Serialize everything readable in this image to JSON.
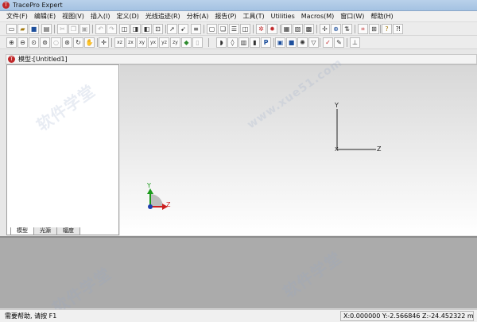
{
  "window": {
    "title": "TracePro Expert"
  },
  "menu": [
    {
      "label": "文件(F)"
    },
    {
      "label": "编辑(E)"
    },
    {
      "label": "视图(V)"
    },
    {
      "label": "插入(I)"
    },
    {
      "label": "定义(D)"
    },
    {
      "label": "光线追迹(R)"
    },
    {
      "label": "分析(A)"
    },
    {
      "label": "报告(P)"
    },
    {
      "label": "工具(T)"
    },
    {
      "label": "Utilities"
    },
    {
      "label": "Macros(M)"
    },
    {
      "label": "窗口(W)"
    },
    {
      "label": "帮助(H)"
    }
  ],
  "document": {
    "title": "模型:[Untitled1]"
  },
  "tree_tabs": [
    {
      "label": "模型"
    },
    {
      "label": "光源"
    },
    {
      "label": "辐度"
    }
  ],
  "viewport": {
    "axis_y": "Y",
    "axis_x": "X",
    "axis_z": "Z",
    "triad_y": "Y",
    "triad_z": "Z"
  },
  "status": {
    "help": "需要帮助, 请按 F1",
    "coordinates": "X:0.000000 Y:-2.566846 Z:-24.452322 mm"
  },
  "watermark": {
    "text": "软件学堂",
    "url": "www.xue51.com"
  }
}
